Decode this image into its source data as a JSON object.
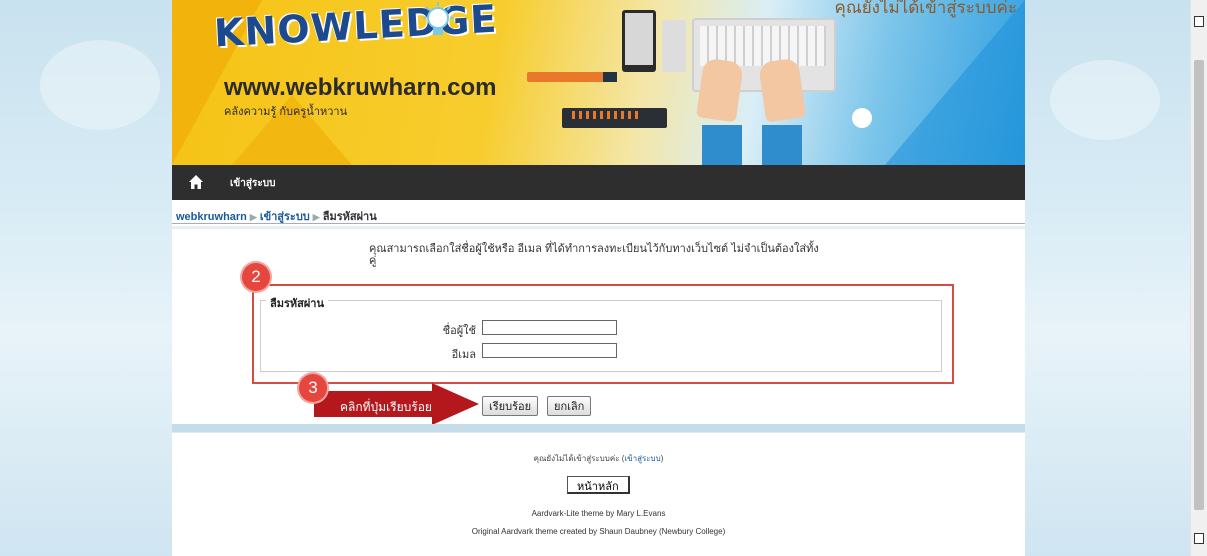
{
  "header": {
    "logo_text": "KNOWLEDGE",
    "site_url": "www.webkruwharn.com",
    "site_tagline": "คลังความรู้ กับครูน้ำหวาน",
    "banner_right_text": "คุณยังไม่ได้เข้าสู่ระบบค่ะ"
  },
  "navbar": {
    "home_icon": "home-icon",
    "login_label": "เข้าสู่ระบบ"
  },
  "breadcrumb": {
    "items": [
      "webkruwharn",
      "เข้าสู่ระบบ",
      "ลืมรหัสผ่าน"
    ],
    "separator": "▶"
  },
  "form": {
    "intro_text": "คุณสามารถเลือกใส่ชื่อผู้ใช้หรือ อีเมล ที่ได้ทำการลงทะเบียนไว้กับทางเว็บไซต์ ไม่จำเป็นต้องใส่ทั้งคู่",
    "legend": "ลืมรหัสผ่าน",
    "username_label": "ชื่อผู้ใช้",
    "username_value": "",
    "email_label": "อีเมล",
    "email_value": "",
    "submit_label": "เรียบร้อย",
    "cancel_label": "ยกเลิก"
  },
  "annotations": {
    "step2": "2",
    "step3": "3",
    "arrow_text": "คลิกที่ปุ่มเรียบร้อย",
    "accent_color": "#d84b43"
  },
  "footer": {
    "status_prefix": "คุณยังไม่ได้เข้าสู่ระบบค่ะ (",
    "status_link": "เข้าสู่ระบบ",
    "status_suffix": ")",
    "home_button": "หน้าหลัก",
    "credit1": "Aardvark-Lite theme by Mary L.Evans",
    "credit2": "Original Aardvark theme created by Shaun Daubney (Newbury College)"
  }
}
